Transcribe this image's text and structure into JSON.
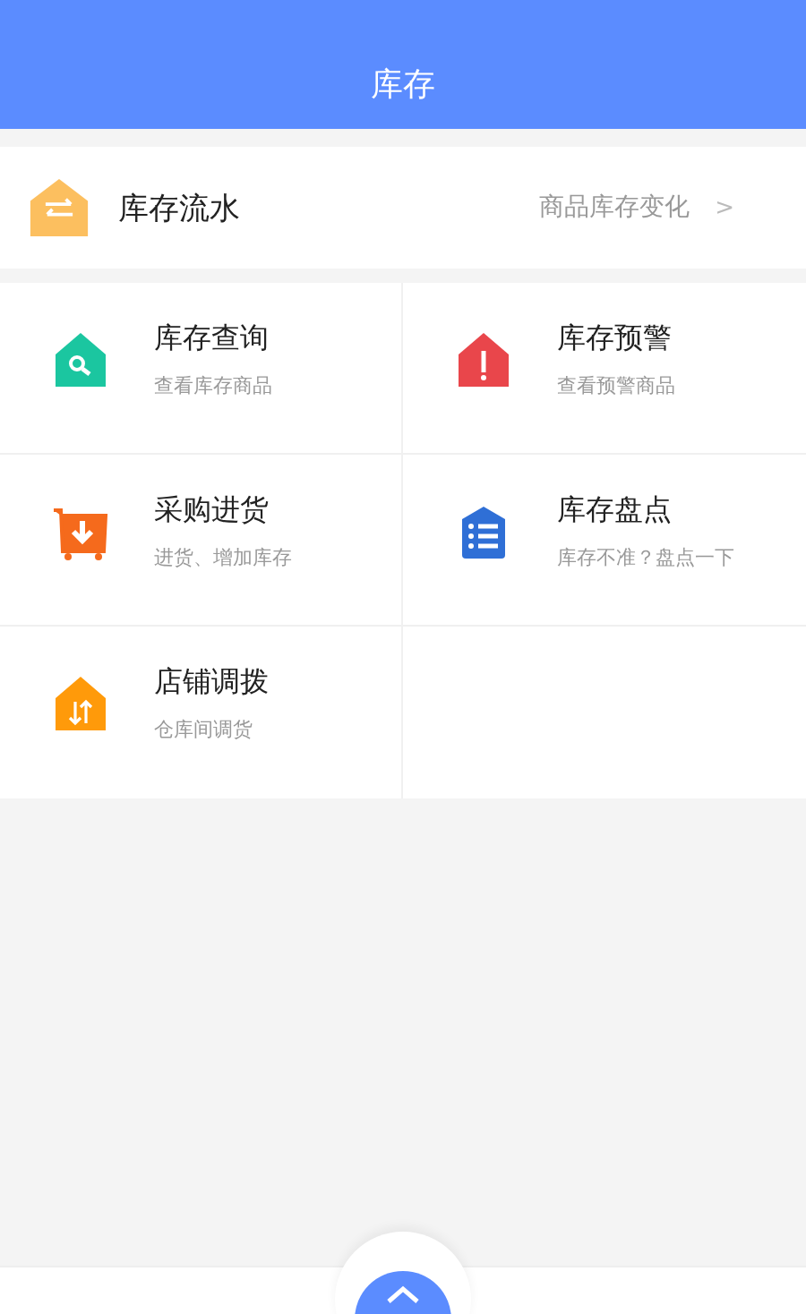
{
  "header": {
    "title": "库存"
  },
  "flow": {
    "title": "库存流水",
    "hint": "商品库存变化",
    "chevron": ">"
  },
  "items": [
    {
      "kind": "search",
      "title": "库存查询",
      "subtitle": "查看库存商品"
    },
    {
      "kind": "warning",
      "title": "库存预警",
      "subtitle": "查看预警商品"
    },
    {
      "kind": "cart",
      "title": "采购进货",
      "subtitle": "进货、增加库存"
    },
    {
      "kind": "list",
      "title": "库存盘点",
      "subtitle": "库存不准？盘点一下"
    },
    {
      "kind": "transfer",
      "title": "店铺调拨",
      "subtitle": "仓库间调货"
    }
  ]
}
